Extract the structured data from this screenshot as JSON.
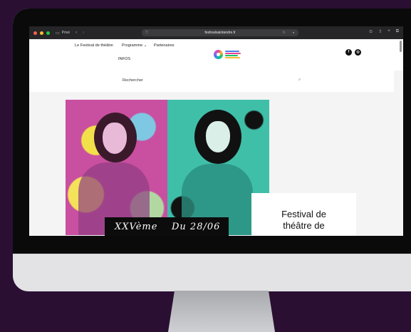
{
  "browser": {
    "tab_mode": "Privé",
    "url": "festivalsaintandre.fr"
  },
  "nav": {
    "items": [
      "Le Festival de théâtre",
      "Programme",
      "Partenaires",
      "INFOS"
    ],
    "programme_chevron": "⌄"
  },
  "search": {
    "placeholder": "Rechercher"
  },
  "hero": {
    "caption_left": "XXVème",
    "caption_right": "Du 28/06",
    "card_line1": "Festival de",
    "card_line2": "théâtre de"
  },
  "colors": {
    "page_bg": "#2a0f33",
    "poster_left": "#c94fa0",
    "poster_right": "#3fbfa8"
  },
  "icons": [
    "sidebar-icon",
    "back-icon",
    "forward-icon",
    "shield-icon",
    "reload-icon",
    "audio-icon",
    "download-icon",
    "share-icon",
    "new-tab-icon",
    "tabs-icon",
    "facebook-icon",
    "instagram-icon",
    "search-icon"
  ]
}
